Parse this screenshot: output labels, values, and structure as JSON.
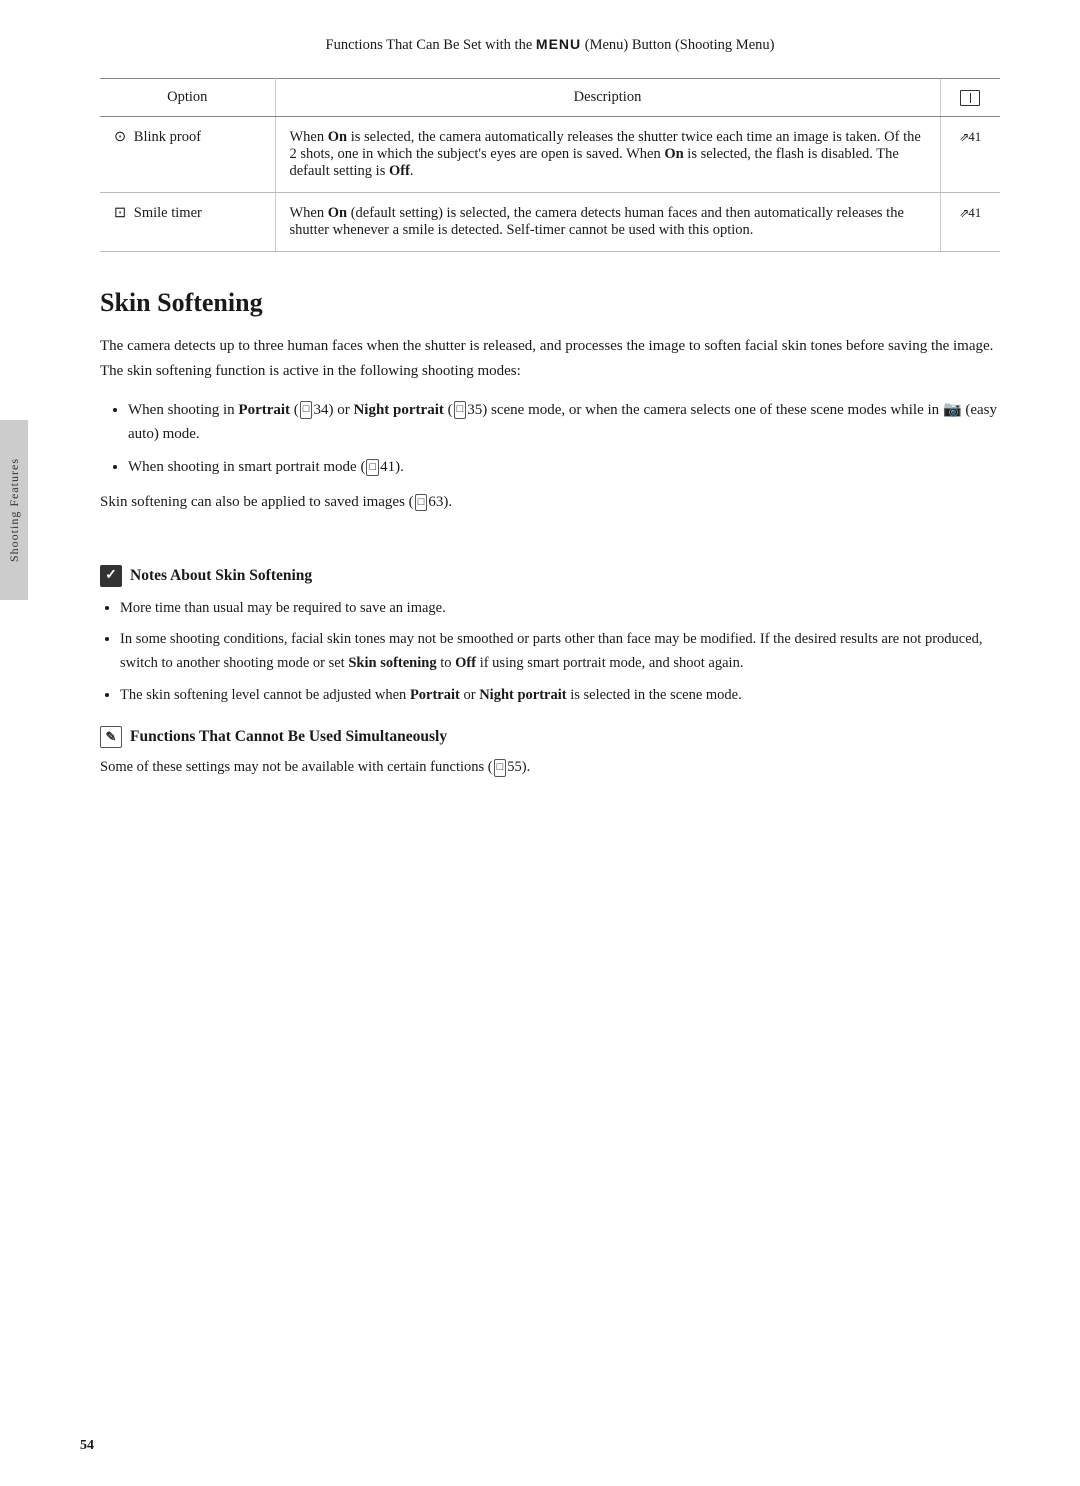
{
  "header": {
    "text": "Functions That Can Be Set with the",
    "menu_word": "MENU",
    "text2": "(Menu) Button (Shooting Menu)"
  },
  "table": {
    "col_option": "Option",
    "col_description": "Description",
    "rows": [
      {
        "option_icon": "⊙",
        "option_text": "Blink proof",
        "description": "When On is selected, the camera automatically releases the shutter twice each time an image is taken. Of the 2 shots, one in which the subject's eyes are open is saved. When On is selected, the flash is disabled. The default setting is Off.",
        "ref": "41"
      },
      {
        "option_icon": "⊡",
        "option_text": "Smile timer",
        "description": "When On (default setting) is selected, the camera detects human faces and then automatically releases the shutter whenever a smile is detected. Self-timer cannot be used with this option.",
        "ref": "41"
      }
    ]
  },
  "skin_softening": {
    "title": "Skin Softening",
    "intro": "The camera detects up to three human faces when the shutter is released, and processes the image to soften facial skin tones before saving the image. The skin softening function is active in the following shooting modes:",
    "bullets": [
      {
        "text_parts": [
          {
            "text": "When shooting in ",
            "bold": false
          },
          {
            "text": "Portrait",
            "bold": true
          },
          {
            "text": " (",
            "bold": false
          },
          {
            "text": "34",
            "bold": false,
            "ref": true
          },
          {
            "text": ") or ",
            "bold": false
          },
          {
            "text": "Night portrait",
            "bold": true
          },
          {
            "text": " (",
            "bold": false
          },
          {
            "text": "35",
            "bold": false,
            "ref": true
          },
          {
            "text": ") scene mode, or when the camera selects one of these scene modes while in ",
            "bold": false
          },
          {
            "text": "🌟",
            "bold": false
          },
          {
            "text": " (easy auto) mode.",
            "bold": false
          }
        ]
      },
      {
        "text_parts": [
          {
            "text": "When shooting in smart portrait mode (",
            "bold": false
          },
          {
            "text": "41",
            "bold": false,
            "ref": true
          },
          {
            "text": ").",
            "bold": false
          }
        ]
      }
    ],
    "extra": "Skin softening can also be applied to saved images (",
    "extra_ref": "63",
    "extra_end": ").",
    "notes_title": "Notes About Skin Softening",
    "notes": [
      "More time than usual may be required to save an image.",
      "In some shooting conditions, facial skin tones may not be smoothed or parts other than face may be modified. If the desired results are not produced, switch to another shooting mode or set Skin softening to Off if using smart portrait mode, and shoot again.",
      "The skin softening level cannot be adjusted when Portrait or Night portrait is selected in the scene mode."
    ],
    "functions_title": "Functions That Cannot Be Used Simultaneously",
    "functions_body": "Some of these settings may not be available with certain functions (",
    "functions_ref": "55",
    "functions_end": ")."
  },
  "sidebar_label": "Shooting Features",
  "page_number": "54"
}
